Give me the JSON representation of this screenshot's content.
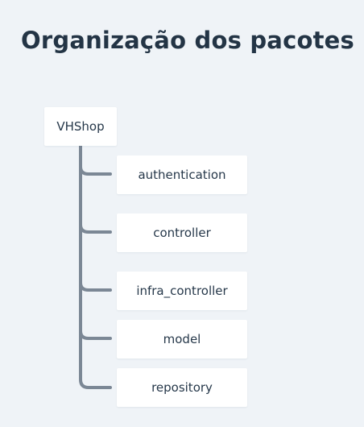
{
  "title": "Organização dos pacotes",
  "tree": {
    "root": "VHShop",
    "children": [
      "authentication",
      "controller",
      "infra_controller",
      "model",
      "repository"
    ]
  },
  "colors": {
    "background": "#eff3f7",
    "title": "#233445",
    "node_background": "#ffffff",
    "connector": "#7b8795"
  }
}
